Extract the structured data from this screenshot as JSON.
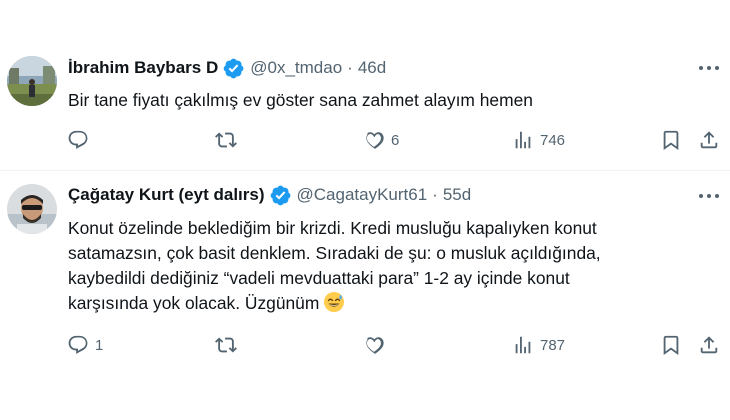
{
  "tweets": [
    {
      "author_name": "İbrahim Baybars D",
      "handle": "@0x_tmdao",
      "separator": "·",
      "time": "46d",
      "verified": true,
      "text_lines": [
        "Bir tane fiyatı çakılmış ev göster sana zahmet alayım hemen"
      ],
      "counts": {
        "replies": "",
        "retweets": "",
        "likes": "6",
        "views": "746"
      }
    },
    {
      "author_name": "Çağatay Kurt (eyt dalırs)",
      "handle": "@CagatayKurt61",
      "separator": "·",
      "time": "55d",
      "verified": true,
      "text_lines": [
        "Konut özelinde beklediğim bir krizdi. Kredi musluğu kapalıyken konut",
        "satamazsın, çok basit denklem. Sıradaki de şu: o musluk açıldığında,",
        "kaybedildi dediğiniz “vadeli mevduattaki para” 1-2 ay içinde konut",
        "karşısında yok olacak. Üzgünüm"
      ],
      "emoji": "sweat-smile-emoji",
      "counts": {
        "replies": "1",
        "retweets": "",
        "likes": "",
        "views": "787"
      }
    }
  ],
  "icons": {
    "reply": "reply-icon",
    "retweet": "retweet-icon",
    "like": "heart-icon",
    "views": "views-icon",
    "bookmark": "bookmark-icon",
    "share": "share-icon",
    "more": "more-icon",
    "verified": "verified-badge-icon"
  },
  "colors": {
    "verified": "#1d9bf0",
    "text": "#0f1419",
    "secondary": "#536471",
    "divider": "#eff3f4"
  }
}
